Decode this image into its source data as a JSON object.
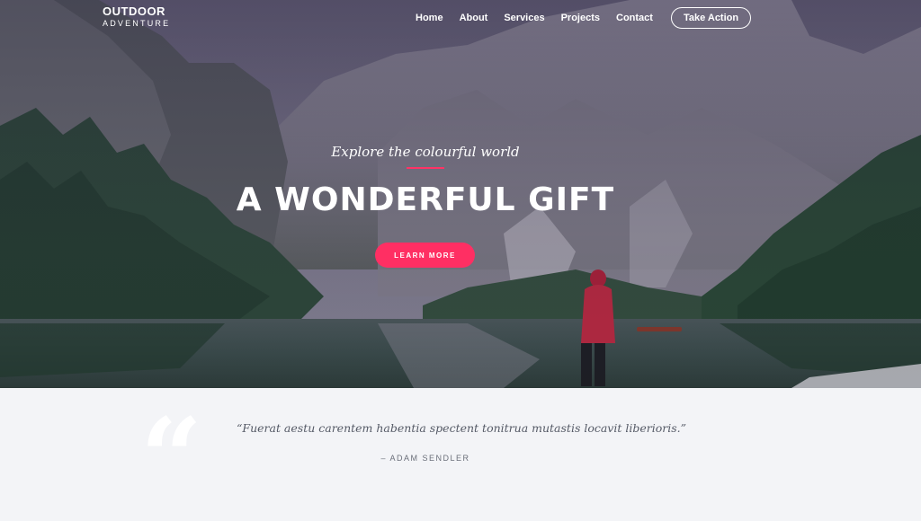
{
  "brand": {
    "name": "OUTDOOR",
    "subtitle": "ADVENTURE"
  },
  "nav": {
    "items": [
      {
        "label": "Home"
      },
      {
        "label": "About"
      },
      {
        "label": "Services"
      },
      {
        "label": "Projects"
      },
      {
        "label": "Contact"
      }
    ],
    "cta_label": "Take Action"
  },
  "hero": {
    "tagline": "Explore the colourful world",
    "headline": "A WONDERFUL GIFT",
    "button_label": "LEARN MORE",
    "accent_color": "#ff2f63"
  },
  "testimonial": {
    "quote": "“Fuerat aestu carentem habentia spectent tonitrua mutastis locavit liberioris.”",
    "author": "– ADAM SENDLER",
    "quote_icon": "quote-icon"
  }
}
